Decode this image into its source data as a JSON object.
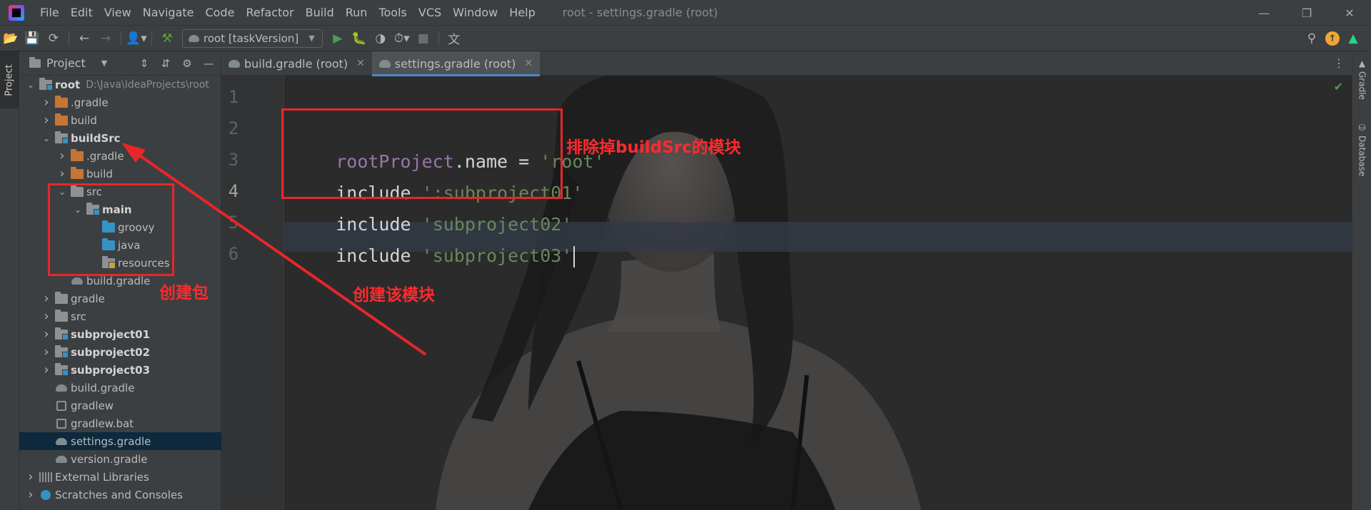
{
  "menubar": {
    "items": [
      "File",
      "Edit",
      "View",
      "Navigate",
      "Code",
      "Refactor",
      "Build",
      "Run",
      "Tools",
      "VCS",
      "Window",
      "Help"
    ],
    "window_title": "root - settings.gradle (root)"
  },
  "toolbar": {
    "run_config": "root [taskVersion]"
  },
  "left_stripe": {
    "project_tab": "Project"
  },
  "project_panel": {
    "title": "Project",
    "tree": [
      {
        "label": "root",
        "path": "D:\\Java\\IdeaProjects\\root",
        "depth": 0,
        "expanded": true,
        "icon": "module-folder",
        "bold": true
      },
      {
        "label": ".gradle",
        "depth": 1,
        "expanded": false,
        "icon": "orange-folder"
      },
      {
        "label": "build",
        "depth": 1,
        "expanded": false,
        "icon": "orange-folder"
      },
      {
        "label": "buildSrc",
        "depth": 1,
        "expanded": true,
        "icon": "module-folder",
        "bold": true
      },
      {
        "label": ".gradle",
        "depth": 2,
        "expanded": false,
        "icon": "orange-folder"
      },
      {
        "label": "build",
        "depth": 2,
        "expanded": false,
        "icon": "orange-folder"
      },
      {
        "label": "src",
        "depth": 2,
        "expanded": true,
        "icon": "folder"
      },
      {
        "label": "main",
        "depth": 3,
        "expanded": true,
        "icon": "module-folder",
        "bold": true
      },
      {
        "label": "groovy",
        "depth": 4,
        "icon": "blue-folder"
      },
      {
        "label": "java",
        "depth": 4,
        "icon": "blue-folder"
      },
      {
        "label": "resources",
        "depth": 4,
        "icon": "resources-folder"
      },
      {
        "label": "build.gradle",
        "depth": 2,
        "icon": "gradle"
      },
      {
        "label": "gradle",
        "depth": 1,
        "expanded": false,
        "icon": "folder"
      },
      {
        "label": "src",
        "depth": 1,
        "expanded": false,
        "icon": "folder"
      },
      {
        "label": "subproject01",
        "depth": 1,
        "expanded": false,
        "icon": "module-folder",
        "bold": true
      },
      {
        "label": "subproject02",
        "depth": 1,
        "expanded": false,
        "icon": "module-folder",
        "bold": true
      },
      {
        "label": "subproject03",
        "depth": 1,
        "expanded": false,
        "icon": "module-folder",
        "bold": true
      },
      {
        "label": "build.gradle",
        "depth": 1,
        "icon": "gradle"
      },
      {
        "label": "gradlew",
        "depth": 1,
        "icon": "terminal"
      },
      {
        "label": "gradlew.bat",
        "depth": 1,
        "icon": "file"
      },
      {
        "label": "settings.gradle",
        "depth": 1,
        "icon": "gradle",
        "selected": true
      },
      {
        "label": "version.gradle",
        "depth": 1,
        "icon": "gradle"
      },
      {
        "label": "External Libraries",
        "depth": 0,
        "expanded": false,
        "icon": "libraries"
      },
      {
        "label": "Scratches and Consoles",
        "depth": 0,
        "expanded": false,
        "icon": "scratch"
      }
    ]
  },
  "editor": {
    "tabs": [
      {
        "label": "build.gradle (root)",
        "active": false
      },
      {
        "label": "settings.gradle (root)",
        "active": true
      }
    ],
    "line_numbers": [
      "1",
      "2",
      "3",
      "4",
      "5",
      "6"
    ],
    "current_line": "4",
    "code": [
      {
        "a": "rootProject",
        "b": ".name = ",
        "c": "'root'"
      },
      {
        "a": "include ",
        "b": "':subproject01'"
      },
      {
        "a": "include ",
        "b": "'subproject02'"
      },
      {
        "a": "include ",
        "b": "'subproject03'"
      }
    ]
  },
  "right_stripe": {
    "gradle_tab": "Gradle",
    "database_tab": "Database"
  },
  "annotations": {
    "exclude_note": "排除掉buildSrc的模块",
    "create_module_note": "创建该模块",
    "create_package_note": "创建包",
    "color": "#e8262a"
  }
}
